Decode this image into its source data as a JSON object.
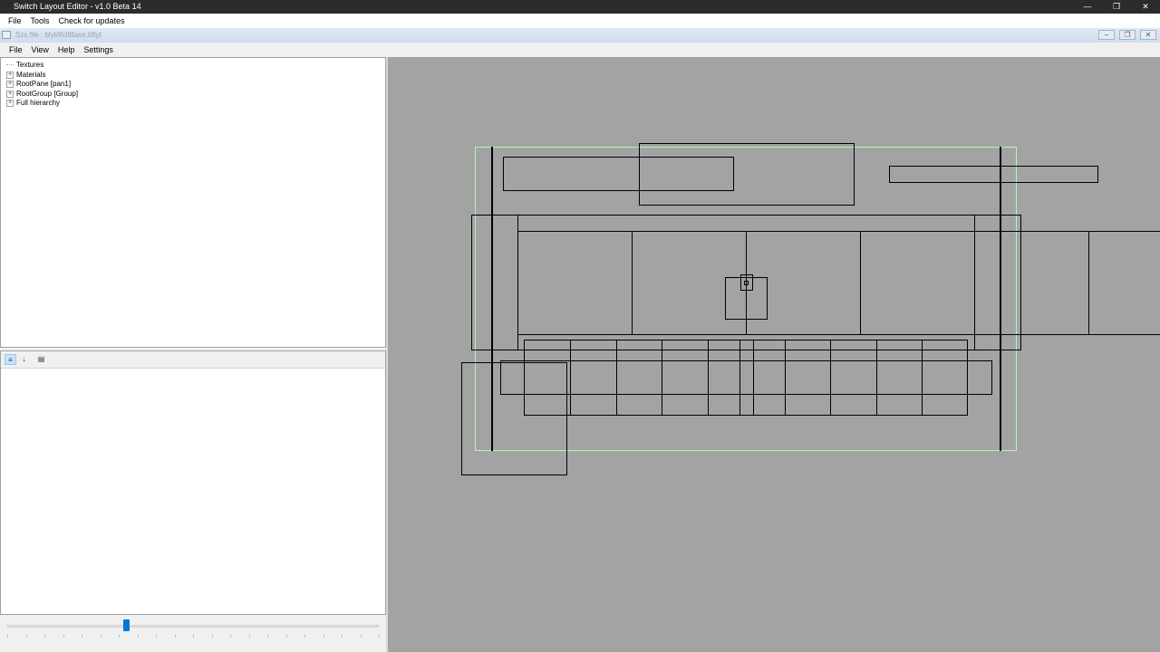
{
  "window": {
    "title": "Switch Layout Editor - v1.0 Beta 14",
    "controls": [
      "minimize-icon",
      "restore-icon",
      "close-icon"
    ]
  },
  "menu": [
    "File",
    "Tools",
    "Check for updates"
  ],
  "document": {
    "title": "Szs file : blyt/RdtBase.bflyt"
  },
  "doc_menu": [
    "File",
    "View",
    "Help",
    "Settings"
  ],
  "tree": [
    {
      "label": "Textures",
      "expandable": false
    },
    {
      "label": "Materials",
      "expandable": true
    },
    {
      "label": "RootPane [pan1]",
      "expandable": true
    },
    {
      "label": "RootGroup [Group]",
      "expandable": true
    },
    {
      "label": "Full hierarchy",
      "expandable": true
    }
  ],
  "property_toolbar": [
    "categorized-icon",
    "alphabetical-icon",
    "property-pages-icon"
  ],
  "zoom_slider": {
    "value": 0.32
  },
  "colors": {
    "canvas": "#a3a3a3",
    "pane_outline": "#000000",
    "root_outline": "#b6f5b6",
    "slider_thumb": "#0078d7"
  }
}
